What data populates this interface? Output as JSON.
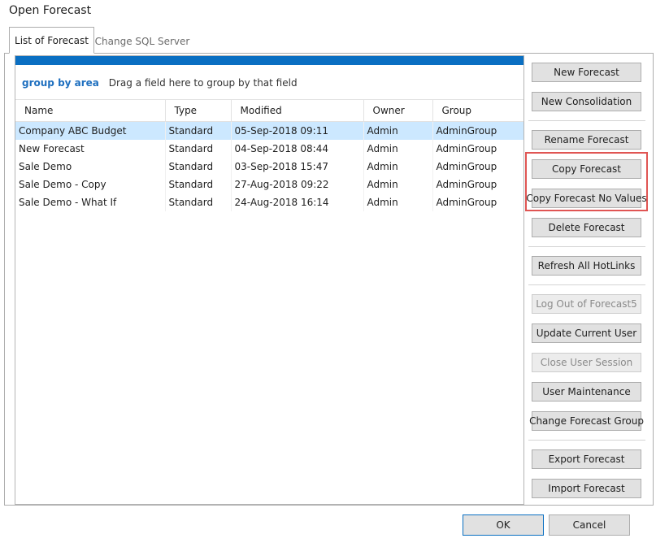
{
  "window": {
    "title": "Open Forecast"
  },
  "tabs": [
    {
      "label": "List of Forecast",
      "active": true
    },
    {
      "label": "Change SQL Server",
      "active": false
    }
  ],
  "groupbar": {
    "label": "group by area",
    "hint": "Drag a field here to group by that field"
  },
  "table": {
    "columns": [
      "Name",
      "Type",
      "Modified",
      "Owner",
      "Group"
    ],
    "rows": [
      [
        "Company ABC Budget",
        "Standard",
        "05-Sep-2018 09:11",
        "Admin",
        "AdminGroup"
      ],
      [
        "New Forecast",
        "Standard",
        "04-Sep-2018 08:44",
        "Admin",
        "AdminGroup"
      ],
      [
        "Sale Demo",
        "Standard",
        "03-Sep-2018 15:47",
        "Admin",
        "AdminGroup"
      ],
      [
        "Sale Demo - Copy",
        "Standard",
        "27-Aug-2018 09:22",
        "Admin",
        "AdminGroup"
      ],
      [
        "Sale Demo - What If",
        "Standard",
        "24-Aug-2018 16:14",
        "Admin",
        "AdminGroup"
      ]
    ]
  },
  "buttons": {
    "new_forecast": "New Forecast",
    "new_consolidation": "New Consolidation",
    "rename_forecast": "Rename Forecast",
    "copy_forecast": "Copy Forecast",
    "copy_forecast_no_values": "Copy Forecast No Values",
    "delete_forecast": "Delete Forecast",
    "refresh_all_hotlinks": "Refresh All HotLinks",
    "log_out": "Log Out of Forecast5",
    "update_current_user": "Update Current User",
    "close_user_session": "Close User Session",
    "user_maintenance": "User Maintenance",
    "change_forecast_group": "Change Forecast Group",
    "export_forecast": "Export Forecast",
    "import_forecast": "Import Forecast"
  },
  "footer": {
    "ok": "OK",
    "cancel": "Cancel"
  },
  "colors": {
    "accent": "#0a6fc2",
    "selection": "#cce8ff",
    "highlight": "#e05553"
  }
}
